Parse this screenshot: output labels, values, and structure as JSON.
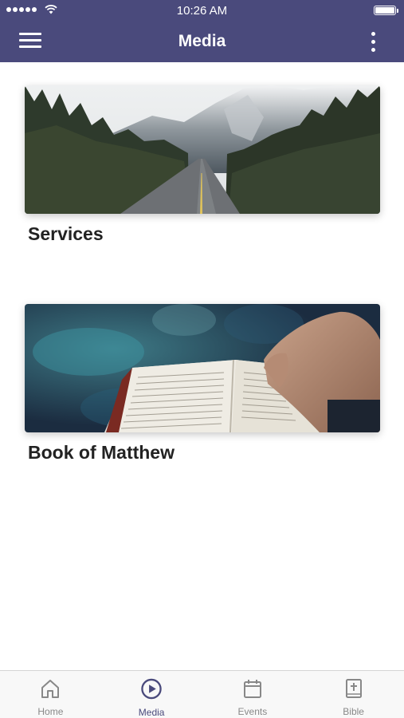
{
  "status_bar": {
    "time": "10:26 AM",
    "signal_bars": 5,
    "battery_level": 1.0
  },
  "header": {
    "title": "Media",
    "menu_icon": "hamburger-menu-icon",
    "more_icon": "more-vertical-icon"
  },
  "media_items": [
    {
      "title": "Services",
      "image": "mountain-road-photo"
    },
    {
      "title": "Book of Matthew",
      "image": "open-bible-photo"
    }
  ],
  "tabbar": {
    "tabs": [
      {
        "label": "Home",
        "icon": "home-icon",
        "active": false
      },
      {
        "label": "Media",
        "icon": "play-circle-icon",
        "active": true
      },
      {
        "label": "Events",
        "icon": "calendar-icon",
        "active": false
      },
      {
        "label": "Bible",
        "icon": "bible-icon",
        "active": false
      }
    ]
  },
  "colors": {
    "header": "#4a4a7c",
    "active_tab": "#4a4a7c",
    "inactive_tab": "#888888"
  }
}
